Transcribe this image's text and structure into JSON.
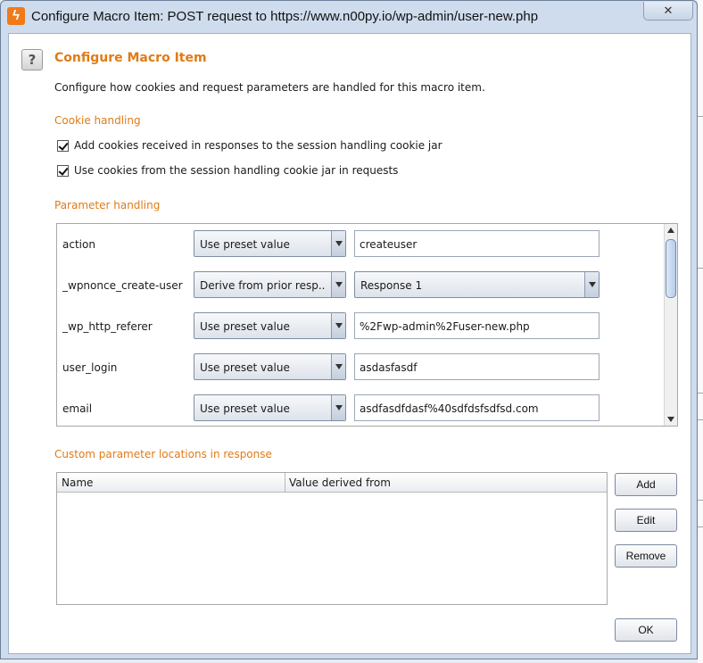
{
  "window": {
    "title": "Configure Macro Item: POST request to https://www.n00py.io/wp-admin/user-new.php",
    "close_label": "✕"
  },
  "header": {
    "help_glyph": "?",
    "heading": "Configure Macro Item",
    "description": "Configure how cookies and request parameters are handled for this macro item."
  },
  "cookie_handling": {
    "label": "Cookie handling",
    "options": [
      {
        "label": "Add cookies received in responses to the session handling cookie jar",
        "checked": true
      },
      {
        "label": "Use cookies from the session handling cookie jar in requests",
        "checked": true
      }
    ]
  },
  "parameter_handling": {
    "label": "Parameter handling",
    "rows": [
      {
        "name": "action",
        "mode": "Use preset value",
        "value": "createuser",
        "value_type": "text"
      },
      {
        "name": "_wpnonce_create-user",
        "mode": "Derive from prior resp...",
        "value": "Response 1",
        "value_type": "select"
      },
      {
        "name": "_wp_http_referer",
        "mode": "Use preset value",
        "value": "%2Fwp-admin%2Fuser-new.php",
        "value_type": "text"
      },
      {
        "name": "user_login",
        "mode": "Use preset value",
        "value": "asdasfasdf",
        "value_type": "text"
      },
      {
        "name": "email",
        "mode": "Use preset value",
        "value": "asdfasdfdasf%40sdfdsfsdfsd.com",
        "value_type": "text"
      }
    ]
  },
  "custom_locations": {
    "label": "Custom parameter locations in response",
    "columns": [
      "Name",
      "Value derived from"
    ],
    "rows": []
  },
  "buttons": {
    "add": "Add",
    "edit": "Edit",
    "remove": "Remove",
    "ok": "OK"
  }
}
